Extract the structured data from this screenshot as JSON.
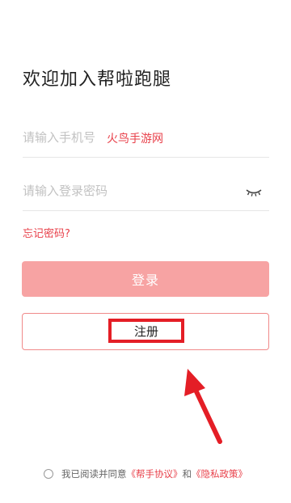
{
  "header": {
    "title": "欢迎加入帮啦跑腿"
  },
  "form": {
    "phone_placeholder": "请输入手机号",
    "phone_overlay": "火鸟手游网",
    "password_placeholder": "请输入登录密码",
    "password_toggle_icon": "eye-closed-icon",
    "forgot_label": "忘记密码?",
    "login_label": "登录",
    "register_label": "注册"
  },
  "agreement": {
    "prefix": "我已阅读并同意",
    "terms_link": "《帮手协议》",
    "connector": "和",
    "privacy_link": "《隐私政策》"
  },
  "colors": {
    "accent": "#e8404a",
    "login_button_bg": "#f7a3a3",
    "annotation_red": "#e41e26"
  }
}
